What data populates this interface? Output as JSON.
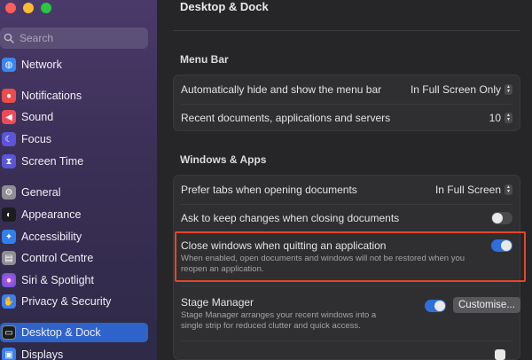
{
  "window": {
    "title": "Desktop & Dock"
  },
  "search": {
    "placeholder": "Search"
  },
  "sidebar": {
    "items": [
      {
        "label": "Network",
        "icon": "globe-icon",
        "color": "#3a86f0"
      },
      {
        "label": "Notifications",
        "icon": "bell-icon",
        "color": "#ee4b4b"
      },
      {
        "label": "Sound",
        "icon": "speaker-icon",
        "color": "#ee4b5a"
      },
      {
        "label": "Focus",
        "icon": "moon-icon",
        "color": "#5b55d8"
      },
      {
        "label": "Screen Time",
        "icon": "hourglass-icon",
        "color": "#5b55d8"
      },
      {
        "label": "General",
        "icon": "gear-icon",
        "color": "#8e8e93"
      },
      {
        "label": "Appearance",
        "icon": "appearance-icon",
        "color": "#1c1c1e"
      },
      {
        "label": "Accessibility",
        "icon": "accessibility-icon",
        "color": "#2f7ff0"
      },
      {
        "label": "Control Centre",
        "icon": "control-centre-icon",
        "color": "#8e8e93"
      },
      {
        "label": "Siri & Spotlight",
        "icon": "siri-icon",
        "color": "#b246e0"
      },
      {
        "label": "Privacy & Security",
        "icon": "hand-icon",
        "color": "#3a7ff0"
      },
      {
        "label": "Desktop & Dock",
        "icon": "dock-icon",
        "color": "#1c1c1e",
        "active": true
      },
      {
        "label": "Displays",
        "icon": "display-icon",
        "color": "#3a7ff0"
      }
    ]
  },
  "menu_bar": {
    "title": "Menu Bar",
    "autohide": {
      "label": "Automatically hide and show the menu bar",
      "value": "In Full Screen Only"
    },
    "recent": {
      "label": "Recent documents, applications and servers",
      "value": "10"
    }
  },
  "windows_apps": {
    "title": "Windows & Apps",
    "prefer_tabs": {
      "label": "Prefer tabs when opening documents",
      "value": "In Full Screen"
    },
    "ask_keep": {
      "label": "Ask to keep changes when closing documents",
      "enabled": false
    },
    "close_windows": {
      "label": "Close windows when quitting an application",
      "description_line1": "When enabled, open documents and windows will not be restored when you",
      "description_line2": "reopen an application.",
      "enabled": true
    },
    "stage_manager": {
      "label": "Stage Manager",
      "description_line1": "Stage Manager arranges your recent windows into a",
      "description_line2": "single strip for reduced clutter and quick access.",
      "enabled": true,
      "button": "Customise..."
    }
  },
  "colors": {
    "accent": "#2f6fdb",
    "highlight": "#e5462a",
    "sidebar_active": "#2e63c9"
  }
}
